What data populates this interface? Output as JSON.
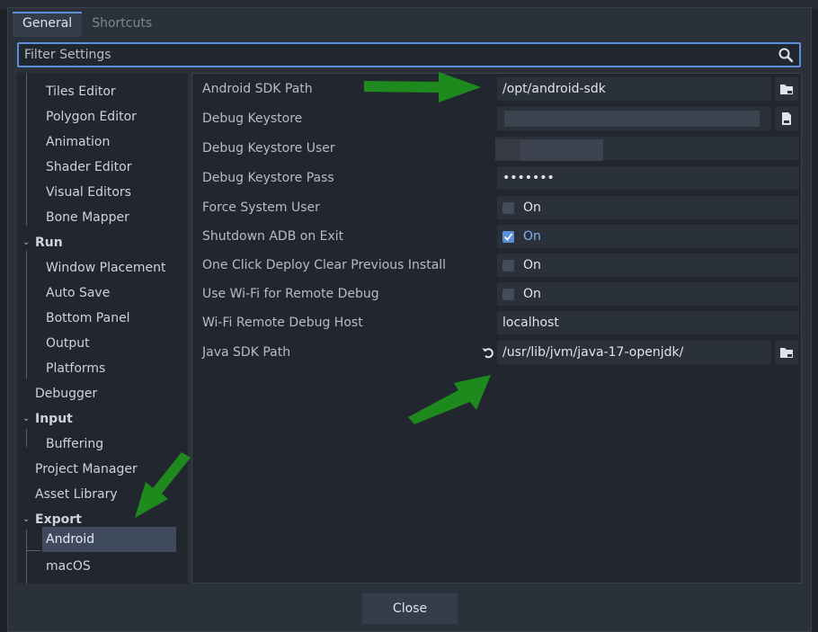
{
  "tabs": [
    "General",
    "Shortcuts"
  ],
  "filter": {
    "placeholder": "Filter Settings",
    "value": ""
  },
  "tree": {
    "items": [
      {
        "label": "Tiles Editor"
      },
      {
        "label": "Polygon Editor"
      },
      {
        "label": "Animation"
      },
      {
        "label": "Shader Editor"
      },
      {
        "label": "Visual Editors"
      },
      {
        "label": "Bone Mapper"
      },
      {
        "label": "Run"
      },
      {
        "label": "Window Placement"
      },
      {
        "label": "Auto Save"
      },
      {
        "label": "Bottom Panel"
      },
      {
        "label": "Output"
      },
      {
        "label": "Platforms"
      },
      {
        "label": "Debugger"
      },
      {
        "label": "Input"
      },
      {
        "label": "Buffering"
      },
      {
        "label": "Project Manager"
      },
      {
        "label": "Asset Library"
      },
      {
        "label": "Export"
      },
      {
        "label": "Android"
      },
      {
        "label": "macOS"
      }
    ]
  },
  "settings": {
    "android_sdk_path": {
      "label": "Android SDK Path",
      "value": "/opt/android-sdk"
    },
    "debug_keystore": {
      "label": "Debug Keystore"
    },
    "debug_keystore_user": {
      "label": "Debug Keystore User"
    },
    "debug_keystore_pass": {
      "label": "Debug Keystore Pass",
      "value": "•••••••"
    },
    "force_system_user": {
      "label": "Force System User",
      "value": "On",
      "checked": false
    },
    "shutdown_adb": {
      "label": "Shutdown ADB on Exit",
      "value": "On",
      "checked": true
    },
    "one_click_deploy": {
      "label": "One Click Deploy Clear Previous Install",
      "value": "On",
      "checked": false
    },
    "use_wifi": {
      "label": "Use Wi-Fi for Remote Debug",
      "value": "On",
      "checked": false
    },
    "wifi_host": {
      "label": "Wi-Fi Remote Debug Host",
      "value": "localhost"
    },
    "java_sdk_path": {
      "label": "Java SDK Path",
      "value": "/usr/lib/jvm/java-17-openjdk/"
    }
  },
  "footer": {
    "close_label": "Close"
  },
  "colors": {
    "accent": "#5a8fd9",
    "arrow": "#1e8a1e",
    "panel": "#22262f"
  },
  "icons": [
    "search-icon",
    "folder-icon",
    "revert-icon",
    "chevron-down-icon",
    "check-icon"
  ]
}
